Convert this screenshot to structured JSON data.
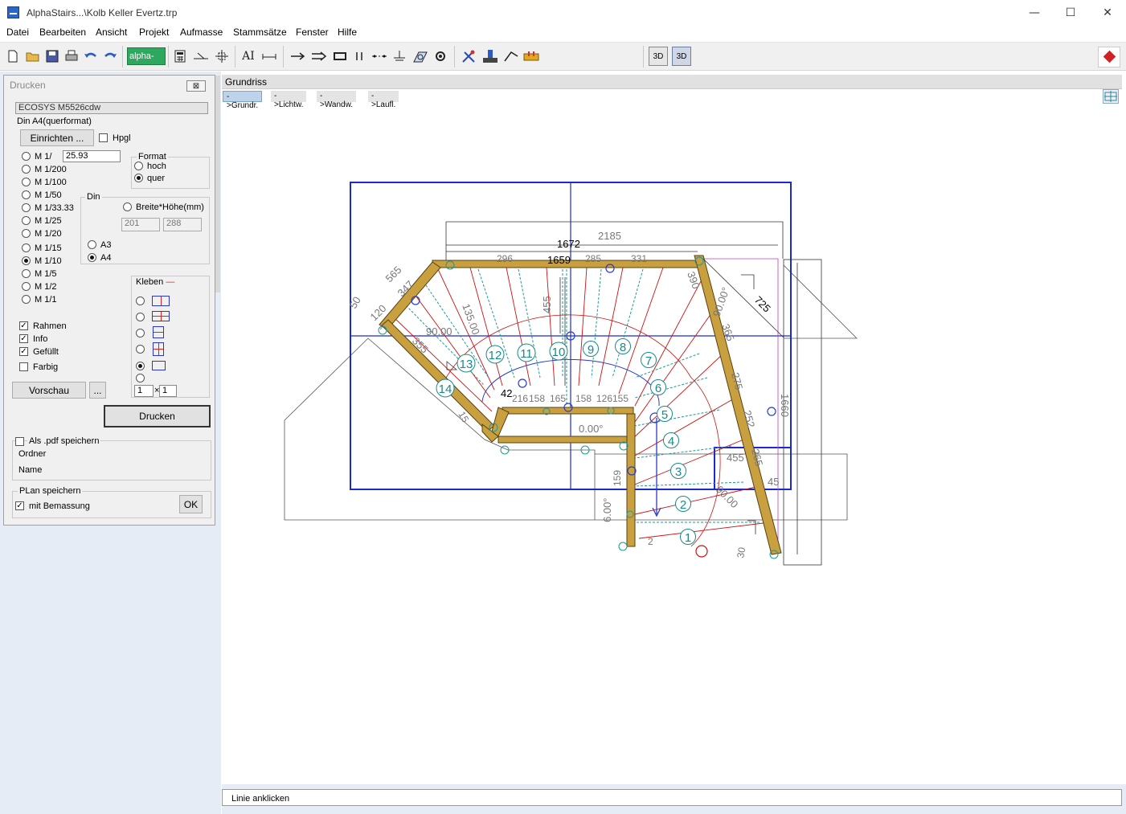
{
  "window": {
    "title": "AlphaStairs...\\Kolb Keller Evertz.trp",
    "minimize": "—",
    "maximize": "☐",
    "close": "✕"
  },
  "menu": [
    "Datei",
    "Bearbeiten",
    "Ansicht",
    "Projekt",
    "Aufmasse",
    "Stammsätze",
    "Fenster",
    "Hilfe"
  ],
  "toolbar": {
    "alpha_label": "alpha-",
    "btn3d_a": "3D",
    "btn3d_b": "3D",
    "text_tool": "AI"
  },
  "print_panel": {
    "title": "Drucken",
    "close_label": "⊠",
    "printer": "ECOSYS M5526cdw",
    "paper": "Din A4(querformat)",
    "setup_button": "Einrichten ...",
    "hpgl_label": "Hpgl",
    "scale_custom_prefix": "M 1/",
    "scale_custom_value": "25.93",
    "scales": [
      "M 1/200",
      "M 1/100",
      "M 1/50",
      "M 1/33.33",
      "M 1/25",
      "M 1/20",
      "M 1/15",
      "M 1/10",
      "M 1/5",
      "M 1/2",
      "M 1/1"
    ],
    "selected_scale": "M 1/10",
    "format_title": "Format",
    "format_options": [
      "hoch",
      "quer"
    ],
    "format_selected": "quer",
    "din_title": "Din",
    "din_custom_label": "Breite*Höhe(mm)",
    "din_width": "201",
    "din_height": "288",
    "din_options": [
      "A3",
      "A4"
    ],
    "din_selected": "A4",
    "kleben_title": "Kleben",
    "kleben_from": "1",
    "kleben_to": "1",
    "checkboxes": [
      {
        "label": "Rahmen",
        "checked": true
      },
      {
        "label": "Info",
        "checked": true
      },
      {
        "label": "Gefüllt",
        "checked": true
      },
      {
        "label": "Farbig",
        "checked": false
      }
    ],
    "preview_button": "Vorschau",
    "more_button": "...",
    "print_button": "Drucken",
    "pdf_title": "Als .pdf speichern",
    "pdf_checked": false,
    "pdf_folder_label": "Ordner",
    "pdf_name_label": "Name",
    "plan_title": "PLan speichern",
    "plan_dim_label": "mit Bemassung",
    "plan_dim_checked": true,
    "ok_button": "OK",
    "check_mark": "✓"
  },
  "drawing": {
    "title": "Grundriss",
    "view_tabs": [
      "->Grundr.",
      "->Lichtw.",
      "->Wandw.",
      "->Laufl."
    ],
    "active_tab": "->Grundr.",
    "step_numbers": [
      "1",
      "2",
      "3",
      "4",
      "5",
      "6",
      "7",
      "8",
      "9",
      "10",
      "11",
      "12",
      "13",
      "14"
    ],
    "dimensions": {
      "d2185": "2185",
      "d1672": "1672",
      "d1659": "1659",
      "d296": "296",
      "d285": "285",
      "d331": "331",
      "d565": "565",
      "d347": "347",
      "d50": "50",
      "d120": "120",
      "d455": "455",
      "d135": "135.00",
      "d90a": "90.00",
      "d355": "355",
      "d42": "42",
      "d0": "0.00°",
      "d725": "725",
      "d390": "390",
      "d90b": "90.00°",
      "d365": "365",
      "d275": "275",
      "d252": "252",
      "d1660": "1660",
      "d455b": "455",
      "d265": "265",
      "d45": "45",
      "d90c": "90.00",
      "d600": "6.00°",
      "d159": "159",
      "d216": "216",
      "d158": "158",
      "d165": "165",
      "d158b": "158",
      "d126": "126",
      "d155": "155",
      "d30": "30",
      "d2s": "2",
      "d15": "15"
    },
    "status": "Linie anklicken"
  }
}
